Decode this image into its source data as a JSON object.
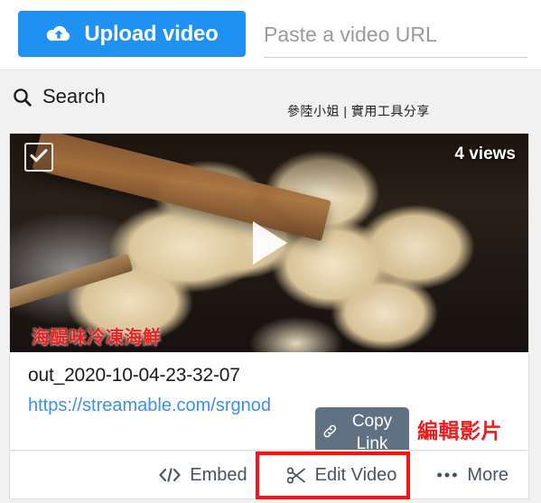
{
  "topbar": {
    "upload_button_label": "Upload video",
    "upload_icon": "cloud-upload-icon",
    "url_placeholder": "Paste a video URL",
    "url_value": ""
  },
  "search": {
    "icon": "search-icon",
    "label": "Search",
    "channel_name": "參陸小姐 | 實用工具分享"
  },
  "video_card": {
    "checkbox_checked": true,
    "checkbox_icon": "check-icon",
    "views": "4 views",
    "play_icon": "play-triangle-icon",
    "watermark": "海醍味冷凍海鮮",
    "title": "out_2020-10-04-23-32-07",
    "url": "https://streamable.com/srgnod",
    "copy_button_label": "Copy Link",
    "copy_button_icon": "link-icon",
    "copy_button_color": "#5f7183"
  },
  "annotation": {
    "edit_video_note": "編輯影片",
    "note_color": "#ee1c1c",
    "highlight_color": "#fc1212"
  },
  "actions": [
    {
      "label": "Embed",
      "icon": "code-icon"
    },
    {
      "label": "Edit Video",
      "icon": "scissors-icon"
    },
    {
      "label": "More",
      "icon": "ellipsis-icon"
    }
  ],
  "colors": {
    "accent_blue": "#1f91f3",
    "link_blue": "#3b8ff0",
    "page_bg": "#f1f1f1"
  }
}
